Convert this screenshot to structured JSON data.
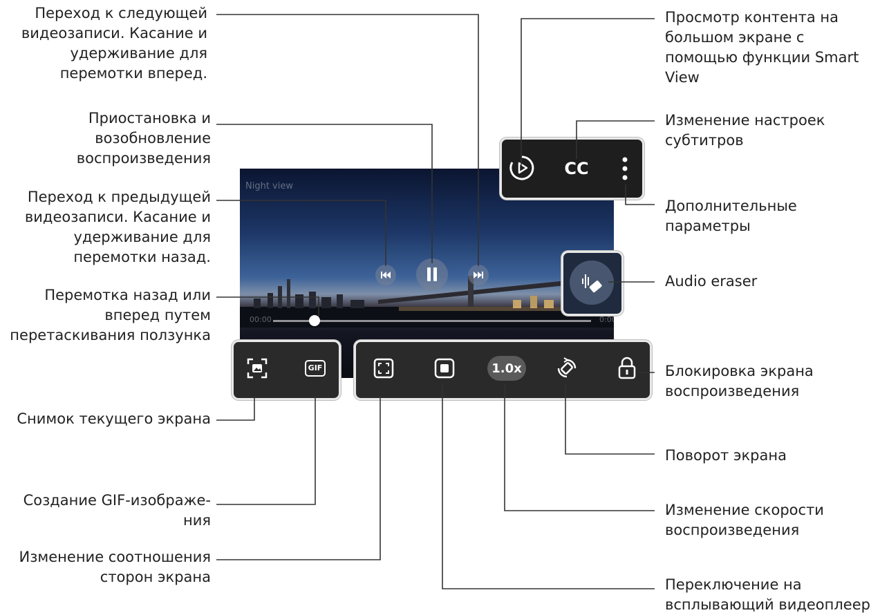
{
  "video": {
    "title": "Night view",
    "time_current": "00:00",
    "time_total": "0:00",
    "progress": 0.13
  },
  "labels": {
    "next": "Переход к следующей\nвидеозаписи. Касание и\nудерживание для\nперемотки вперед.",
    "pause": "Приостановка и\nвозобновление\nвоспроизведения",
    "prev": "Переход к предыдущей\nвидеозаписи. Касание и\nудерживание для\nперемотки назад.",
    "seek": "Перемотка назад или\nвперед путем\nперетаскивания ползунка",
    "capture": "Снимок текущего экрана",
    "gif": "Создание GIF-изображе-\nния",
    "ratio": "Изменение соотношения\nсторон экрана",
    "smart_view": "Просмотр контента на\nбольшом экране с\nпомощью функции Smart\nView",
    "subtitles": "Изменение настроек\nсубтитров",
    "more": "Дополнительные\nпараметры",
    "audio_eraser": "Audio eraser",
    "lock": "Блокировка экрана\nвоспроизведения",
    "rotate": "Поворот экрана",
    "speed": "Изменение скорости\nвоспроизведения",
    "popup": "Переключение на\nвсплывающий видеоплеер"
  },
  "buttons": {
    "cc": "CC",
    "gif": "GIF",
    "speed": "1.0x"
  }
}
